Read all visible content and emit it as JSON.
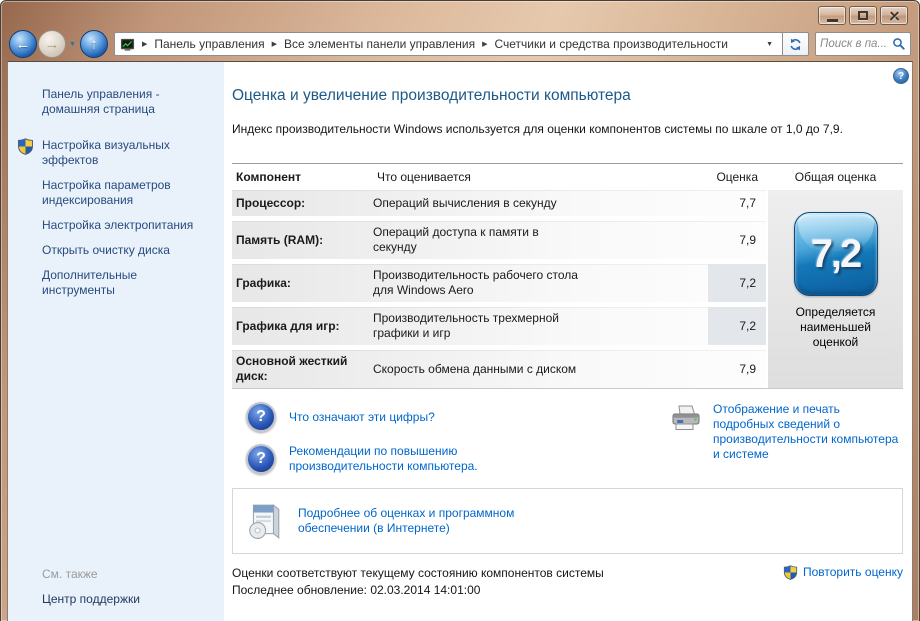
{
  "colors": {
    "accent_link": "#0066cc",
    "heading": "#1d5987",
    "sidebar_link": "#284b7e",
    "badge_blue": "#1478b8",
    "frame_tan": "#d8b597"
  },
  "icons": {
    "crumb_separator": "▶",
    "dropdown_arrow": "▼",
    "back_arrow": "←",
    "forward_arrow": "→",
    "up_arrow": "↑",
    "question_mark": "?"
  },
  "toolbar": {
    "breadcrumb": [
      {
        "label": "Панель управления"
      },
      {
        "label": "Все элементы панели управления"
      },
      {
        "label": "Счетчики и средства производительности"
      }
    ],
    "search_placeholder": "Поиск в па..."
  },
  "sidebar": {
    "home_link": "Панель управления - домашняя страница",
    "items": [
      {
        "label": "Настройка визуальных эффектов"
      },
      {
        "label": "Настройка параметров индексирования"
      },
      {
        "label": "Настройка электропитания"
      },
      {
        "label": "Открыть очистку диска"
      },
      {
        "label": "Дополнительные инструменты"
      }
    ],
    "see_also": "См. также",
    "support_center": "Центр поддержки"
  },
  "main": {
    "title": "Оценка и увеличение производительности компьютера",
    "intro": "Индекс производительности Windows используется для оценки компонентов системы по шкале от 1,0 до 7,9.",
    "table": {
      "headers": {
        "component": "Компонент",
        "description": "Что оценивается",
        "score": "Оценка",
        "overall": "Общая оценка"
      },
      "rows": [
        {
          "component": "Процессор:",
          "what": "Операций вычисления в секунду",
          "score": "7,7",
          "lowest": false
        },
        {
          "component": "Память (RAM):",
          "what": "Операций доступа к памяти в секунду",
          "score": "7,9",
          "lowest": false
        },
        {
          "component": "Графика:",
          "what": "Производительность рабочего стола для Windows Aero",
          "score": "7,2",
          "lowest": true
        },
        {
          "component": "Графика для игр:",
          "what": "Производительность трехмерной графики и игр",
          "score": "7,2",
          "lowest": true
        },
        {
          "component": "Основной жесткий диск:",
          "what": "Скорость обмена данными с диском",
          "score": "7,9",
          "lowest": false
        }
      ],
      "base_score": "7,2",
      "base_score_caption": "Определяется наименьшей оценкой"
    },
    "links": {
      "what_numbers": "Что означают эти цифры?",
      "improve_tips": "Рекомендации по повышению производительности компьютера.",
      "print_details": "Отображение и печать подробных сведений о производительности компьютера и системе",
      "online_info": "Подробнее об оценках и программном обеспечении (в Интернете)"
    },
    "footer": {
      "status": "Оценки соответствуют текущему состоянию компонентов системы",
      "last_update": "Последнее обновление: 02.03.2014 14:01:00",
      "rerun": "Повторить оценку"
    }
  }
}
